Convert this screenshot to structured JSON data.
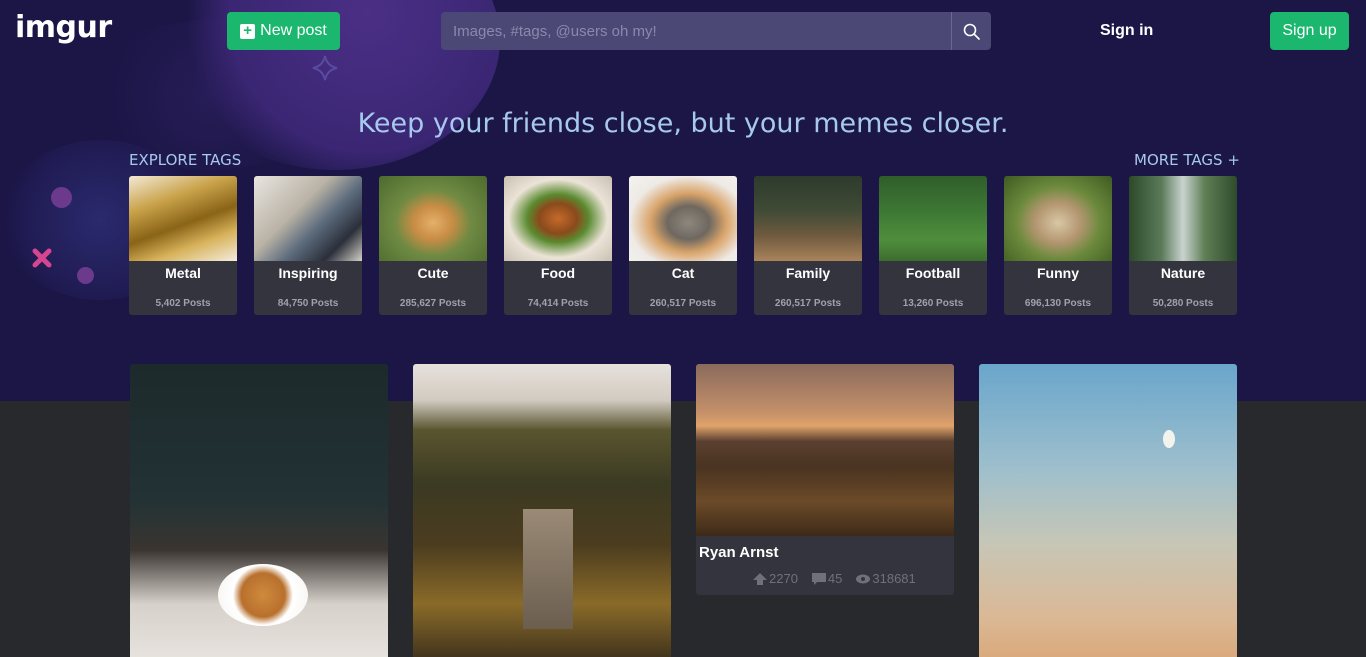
{
  "header": {
    "logo": "imgur",
    "new_post_label": "New post",
    "search_placeholder": "Images, #tags, @users oh my!",
    "sign_in_label": "Sign in",
    "sign_up_label": "Sign up"
  },
  "hero": {
    "tagline": "Keep your friends close, but your memes closer.",
    "explore_label": "EXPLORE TAGS",
    "more_tags_label": "MORE TAGS +"
  },
  "tags": [
    {
      "name": "Metal",
      "count": "5,402 Posts"
    },
    {
      "name": "Inspiring",
      "count": "84,750 Posts"
    },
    {
      "name": "Cute",
      "count": "285,627 Posts"
    },
    {
      "name": "Food",
      "count": "74,414 Posts"
    },
    {
      "name": "Cat",
      "count": "260,517 Posts"
    },
    {
      "name": "Family",
      "count": "260,517 Posts"
    },
    {
      "name": "Football",
      "count": "13,260 Posts"
    },
    {
      "name": "Funny",
      "count": "696,130 Posts"
    },
    {
      "name": "Nature",
      "count": "50,280 Posts"
    }
  ],
  "posts": [
    {
      "title": "Ryan Arnst",
      "upvotes": "2270",
      "comments": "45",
      "views": "318681"
    }
  ],
  "colors": {
    "hero_bg": "#1b1646",
    "page_bg": "#27292d",
    "accent_green": "#1bb76e",
    "tagline_blue": "#a7c9ee",
    "card_bg": "#33343e"
  }
}
